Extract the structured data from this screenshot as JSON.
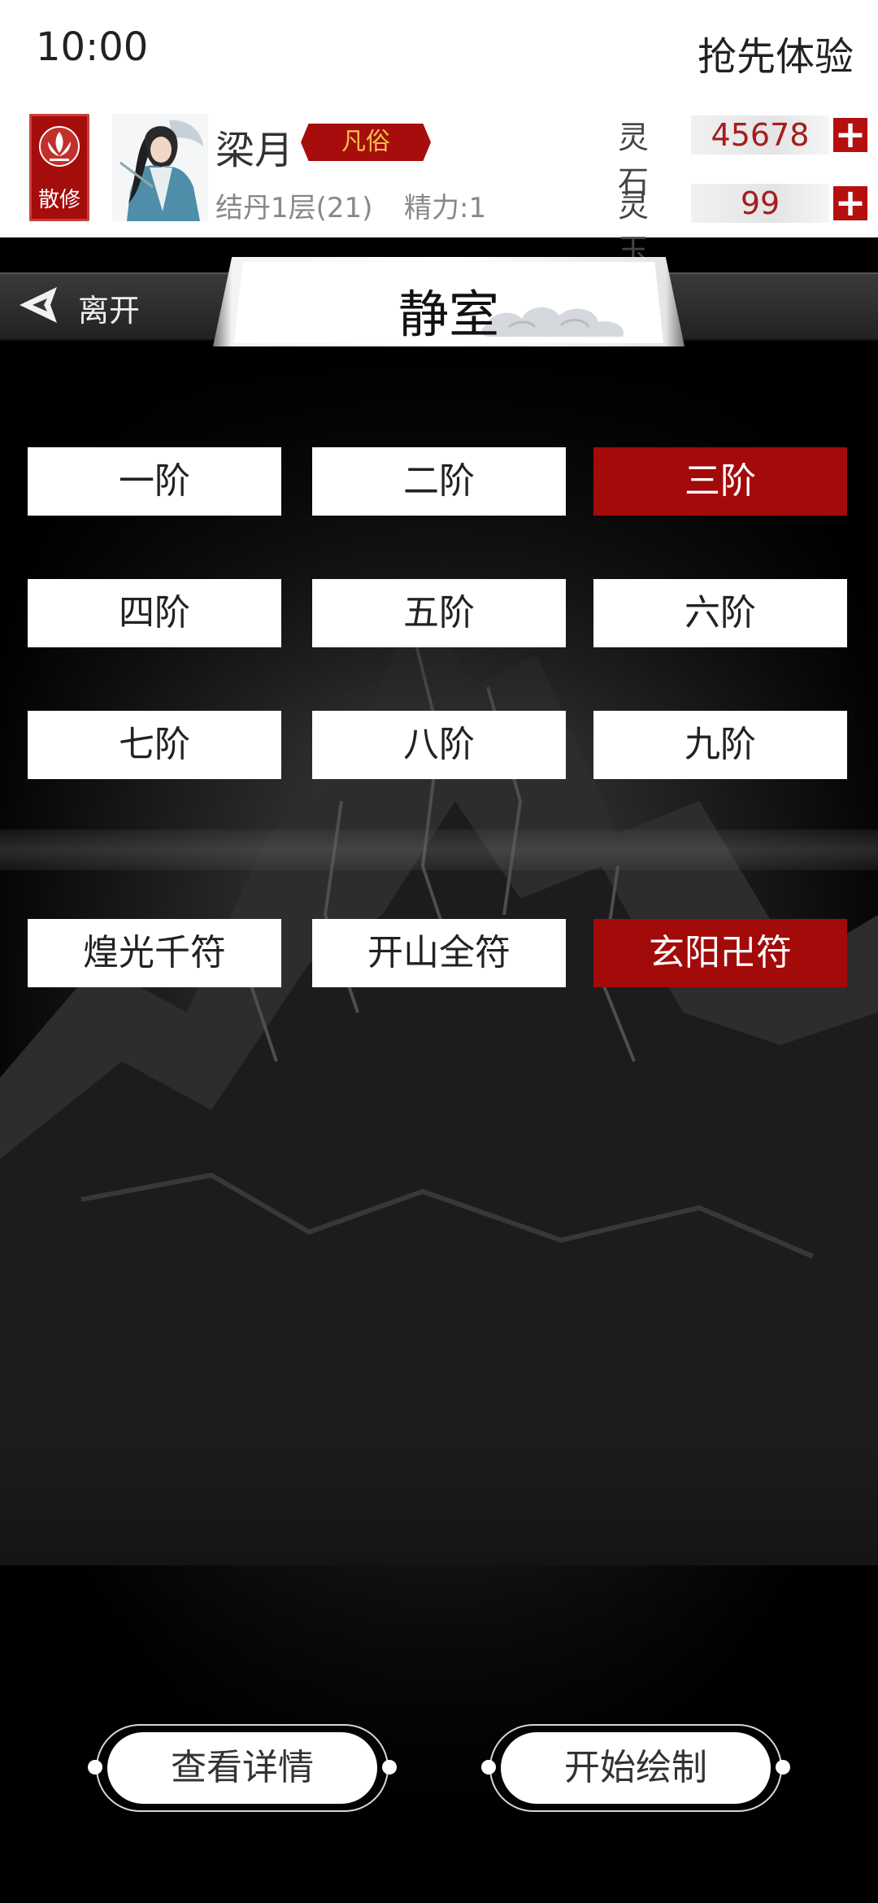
{
  "status": {
    "time": "10:00",
    "early_access": "抢先体验"
  },
  "player": {
    "sect_badge": "散修",
    "name": "梁月",
    "rank_tag": "凡俗",
    "realm": "结丹1层(21)",
    "energy": "精力:1"
  },
  "resources": [
    {
      "label": "灵石",
      "value": "45678"
    },
    {
      "label": "灵玉",
      "value": "99"
    }
  ],
  "header": {
    "leave": "离开",
    "title": "静室"
  },
  "tiers": [
    {
      "label": "一阶",
      "selected": false
    },
    {
      "label": "二阶",
      "selected": false
    },
    {
      "label": "三阶",
      "selected": true
    },
    {
      "label": "四阶",
      "selected": false
    },
    {
      "label": "五阶",
      "selected": false
    },
    {
      "label": "六阶",
      "selected": false
    },
    {
      "label": "七阶",
      "selected": false
    },
    {
      "label": "八阶",
      "selected": false
    },
    {
      "label": "九阶",
      "selected": false
    }
  ],
  "talismans": [
    {
      "label": "煌光千符",
      "selected": false
    },
    {
      "label": "开山全符",
      "selected": false
    },
    {
      "label": "玄阳卍符",
      "selected": true
    }
  ],
  "actions": {
    "view_details": "查看详情",
    "start_drawing": "开始绘制"
  },
  "colors": {
    "accent_red": "#a30a0a",
    "gold_text": "#f4c24a"
  }
}
